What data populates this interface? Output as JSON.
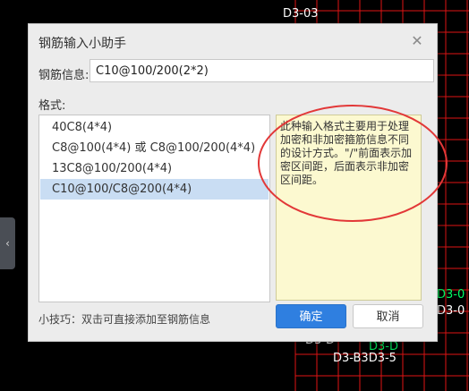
{
  "dialog": {
    "title": "钢筋输入小助手",
    "info_label": "钢筋信息:",
    "info_value": "C10@100/200(2*2)",
    "format_label": "格式:",
    "formats": [
      {
        "label": "40C8(4*4)"
      },
      {
        "label": "C8@100(4*4) 或 C8@100/200(4*4)"
      },
      {
        "label": "13C8@100/200(4*4)"
      },
      {
        "label": "C10@100/C8@200(4*4)",
        "selected": true
      }
    ],
    "description": "此种输入格式主要用于处理加密和非加密箍筋信息不同的设计方式。\"/\"前面表示加密区间距，后面表示非加密区间距。",
    "tip": "小技巧：双击可直接添加至钢筋信息",
    "ok_label": "确定",
    "cancel_label": "取消"
  },
  "cad_labels": [
    "D3-03",
    "D3-0",
    "D3-0",
    "D3-D",
    "D3-D",
    "D3-B3D3-5"
  ],
  "colors": {
    "grid": "#e01414",
    "annotation": "#ff3b3b",
    "primary_button": "#2f7fe0",
    "selected_row": "#c9ddf3",
    "description_bg": "#fcf9d0"
  }
}
